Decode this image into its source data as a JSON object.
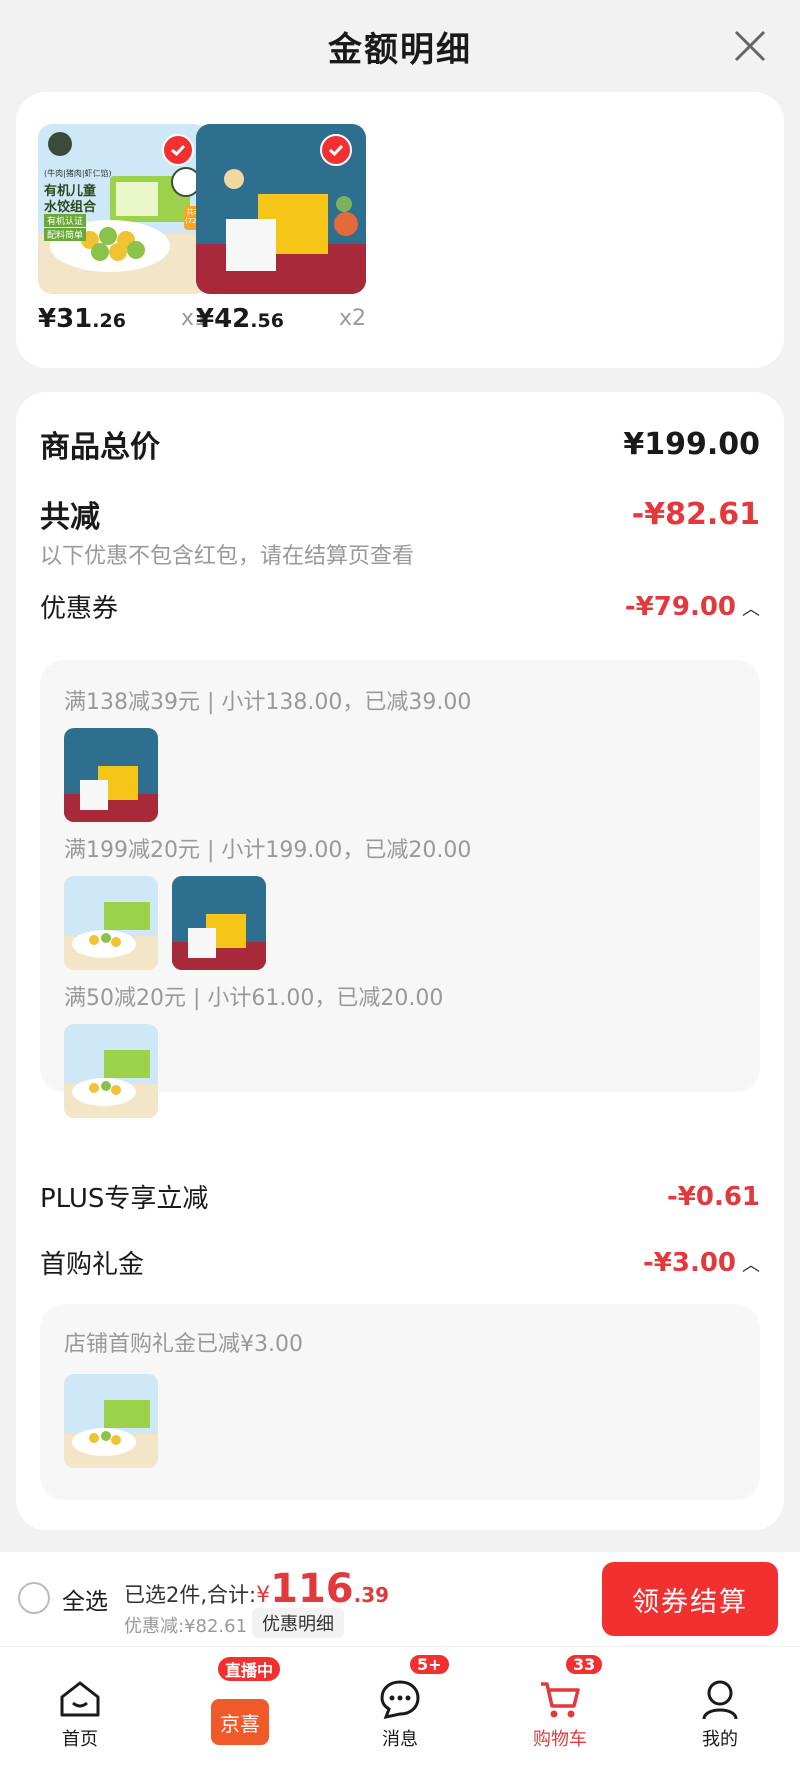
{
  "header": {
    "title": "金额明细"
  },
  "products": [
    {
      "price_main": "¥31",
      "price_dec": ".26",
      "qty": "x1",
      "box_text": [
        "(牛肉|猪肉|虾仁馅)",
        "有机儿童",
        "水饺组合",
        "有机认证",
        "配料简单"
      ],
      "badge": "共3盒",
      "badge2": "(72只)"
    },
    {
      "price_main": "¥42",
      "price_dec": ".56",
      "qty": "x2"
    }
  ],
  "detail": {
    "total_label": "商品总价",
    "total_value": "¥199.00",
    "reduce_label": "共减",
    "reduce_value": "-¥82.61",
    "note": "以下优惠不包含红包，请在结算页查看",
    "coupon_label": "优惠券",
    "coupon_value": "-¥79.00",
    "coupon_groups": [
      {
        "text": "满138减39元 | 小计138.00，已减39.00"
      },
      {
        "text": "满199减20元 | 小计199.00，已减20.00"
      },
      {
        "text": "满50减20元 | 小计61.00，已减20.00"
      }
    ],
    "plus_label": "PLUS专享立减",
    "plus_value": "-¥0.61",
    "gift_label": "首购礼金",
    "gift_value": "-¥3.00",
    "gift_group_text": "店铺首购礼金已减¥3.00"
  },
  "bottom": {
    "select_all": "全选",
    "summary_prefix": "已选2件,合计:",
    "yen": "¥",
    "total_int": "116",
    "total_dec": ".39",
    "discount_text": "优惠减:¥82.61",
    "discount_btn": "优惠明细",
    "checkout": "领券结算"
  },
  "tabs": [
    {
      "label": "首页",
      "icon": "home-icon"
    },
    {
      "label": "京喜",
      "icon": "jingxi-icon",
      "badge": "直播中"
    },
    {
      "label": "消息",
      "icon": "message-icon",
      "badge": "5+"
    },
    {
      "label": "购物车",
      "icon": "cart-icon",
      "badge": "33",
      "active": true
    },
    {
      "label": "我的",
      "icon": "user-icon"
    }
  ],
  "colors": {
    "accent": "#e4393c",
    "checkout": "#f23030"
  }
}
